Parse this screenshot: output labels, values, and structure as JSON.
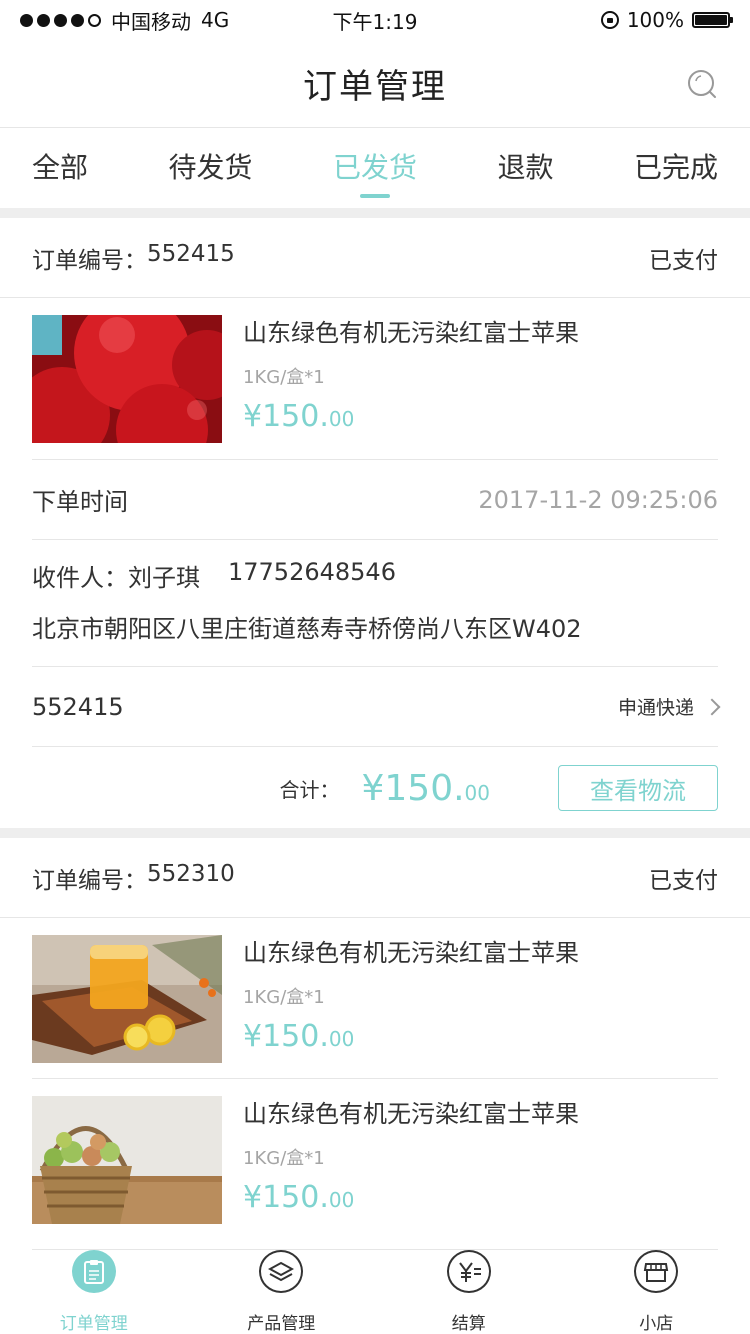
{
  "status_bar": {
    "carrier": "中国移动",
    "network": "4G",
    "time": "下午1:19",
    "battery": "100%"
  },
  "header": {
    "title": "订单管理",
    "search_icon": "search-icon"
  },
  "tabs": [
    {
      "label": "全部"
    },
    {
      "label": "待发货"
    },
    {
      "label": "已发货",
      "active": true
    },
    {
      "label": "退款"
    },
    {
      "label": "已完成"
    }
  ],
  "colors": {
    "accent": "#7fd3cf",
    "text": "#333333",
    "muted": "#a5a5a5",
    "divider": "#e6e6e6"
  },
  "orders": [
    {
      "order_label": "订单编号：",
      "order_no": "552415",
      "status": "已支付",
      "products": [
        {
          "name": "山东绿色有机无污染红富士苹果",
          "spec": "1KG/盒*1",
          "price_main": "¥150.",
          "price_decimal": "00",
          "image": "red-apples"
        }
      ],
      "time_label": "下单时间",
      "time_value": "2017-11-2 09:25:06",
      "recipient_label": "收件人：",
      "recipient_name": "刘子琪",
      "recipient_phone": "17752648546",
      "address": "北京市朝阳区八里庄街道慈寿寺桥傍尚八东区W402",
      "tracking_no": "552415",
      "express": "申通快递",
      "total_label": "合计：",
      "total_main": "¥150.",
      "total_decimal": "00",
      "logistics_button": "查看物流"
    },
    {
      "order_label": "订单编号：",
      "order_no": "552310",
      "status": "已支付",
      "products": [
        {
          "name": "山东绿色有机无污染红富士苹果",
          "spec": "1KG/盒*1",
          "price_main": "¥150.",
          "price_decimal": "00",
          "image": "orange-juice"
        },
        {
          "name": "山东绿色有机无污染红富士苹果",
          "spec": "1KG/盒*1",
          "price_main": "¥150.",
          "price_decimal": "00",
          "image": "fruit-basket"
        }
      ]
    }
  ],
  "bottom_nav": [
    {
      "label": "订单管理",
      "icon": "clipboard-icon",
      "active": true
    },
    {
      "label": "产品管理",
      "icon": "layers-icon"
    },
    {
      "label": "结算",
      "icon": "yen-icon"
    },
    {
      "label": "小店",
      "icon": "store-icon"
    }
  ]
}
